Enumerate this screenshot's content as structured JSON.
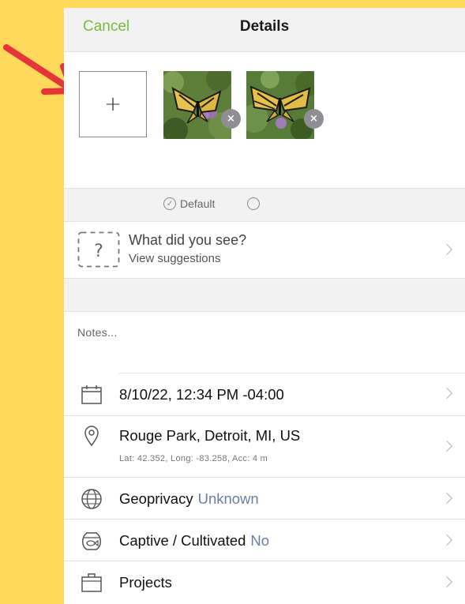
{
  "navbar": {
    "cancel_label": "Cancel",
    "title": "Details"
  },
  "photos": {
    "add_icon": "+",
    "close_icon": "×",
    "default_label": "Default",
    "default_check_icon": "✓"
  },
  "suggestions": {
    "title": "What did you see?",
    "subtitle": "View suggestions",
    "icon": "?"
  },
  "notes": {
    "placeholder": "Notes..."
  },
  "rows": {
    "date": {
      "label": "8/10/22, 12:34 PM -04:00",
      "icon": "calendar-icon"
    },
    "location": {
      "label": "Rouge Park, Detroit, MI, US",
      "detail": "Lat: 42.352, Long: -83.258, Acc: 4 m",
      "icon": "location-pin-icon"
    },
    "geoprivacy": {
      "label": "Geoprivacy",
      "value": "Unknown",
      "icon": "globe-icon"
    },
    "captive": {
      "label": "Captive / Cultivated",
      "value": "No",
      "icon": "fishbowl-icon"
    },
    "projects": {
      "label": "Projects",
      "icon": "briefcase-icon"
    }
  },
  "colors": {
    "background": "#FFD95A",
    "accent": "#7CB83B",
    "value_text": "#6B7FA3",
    "arrow": "#E8333A"
  }
}
